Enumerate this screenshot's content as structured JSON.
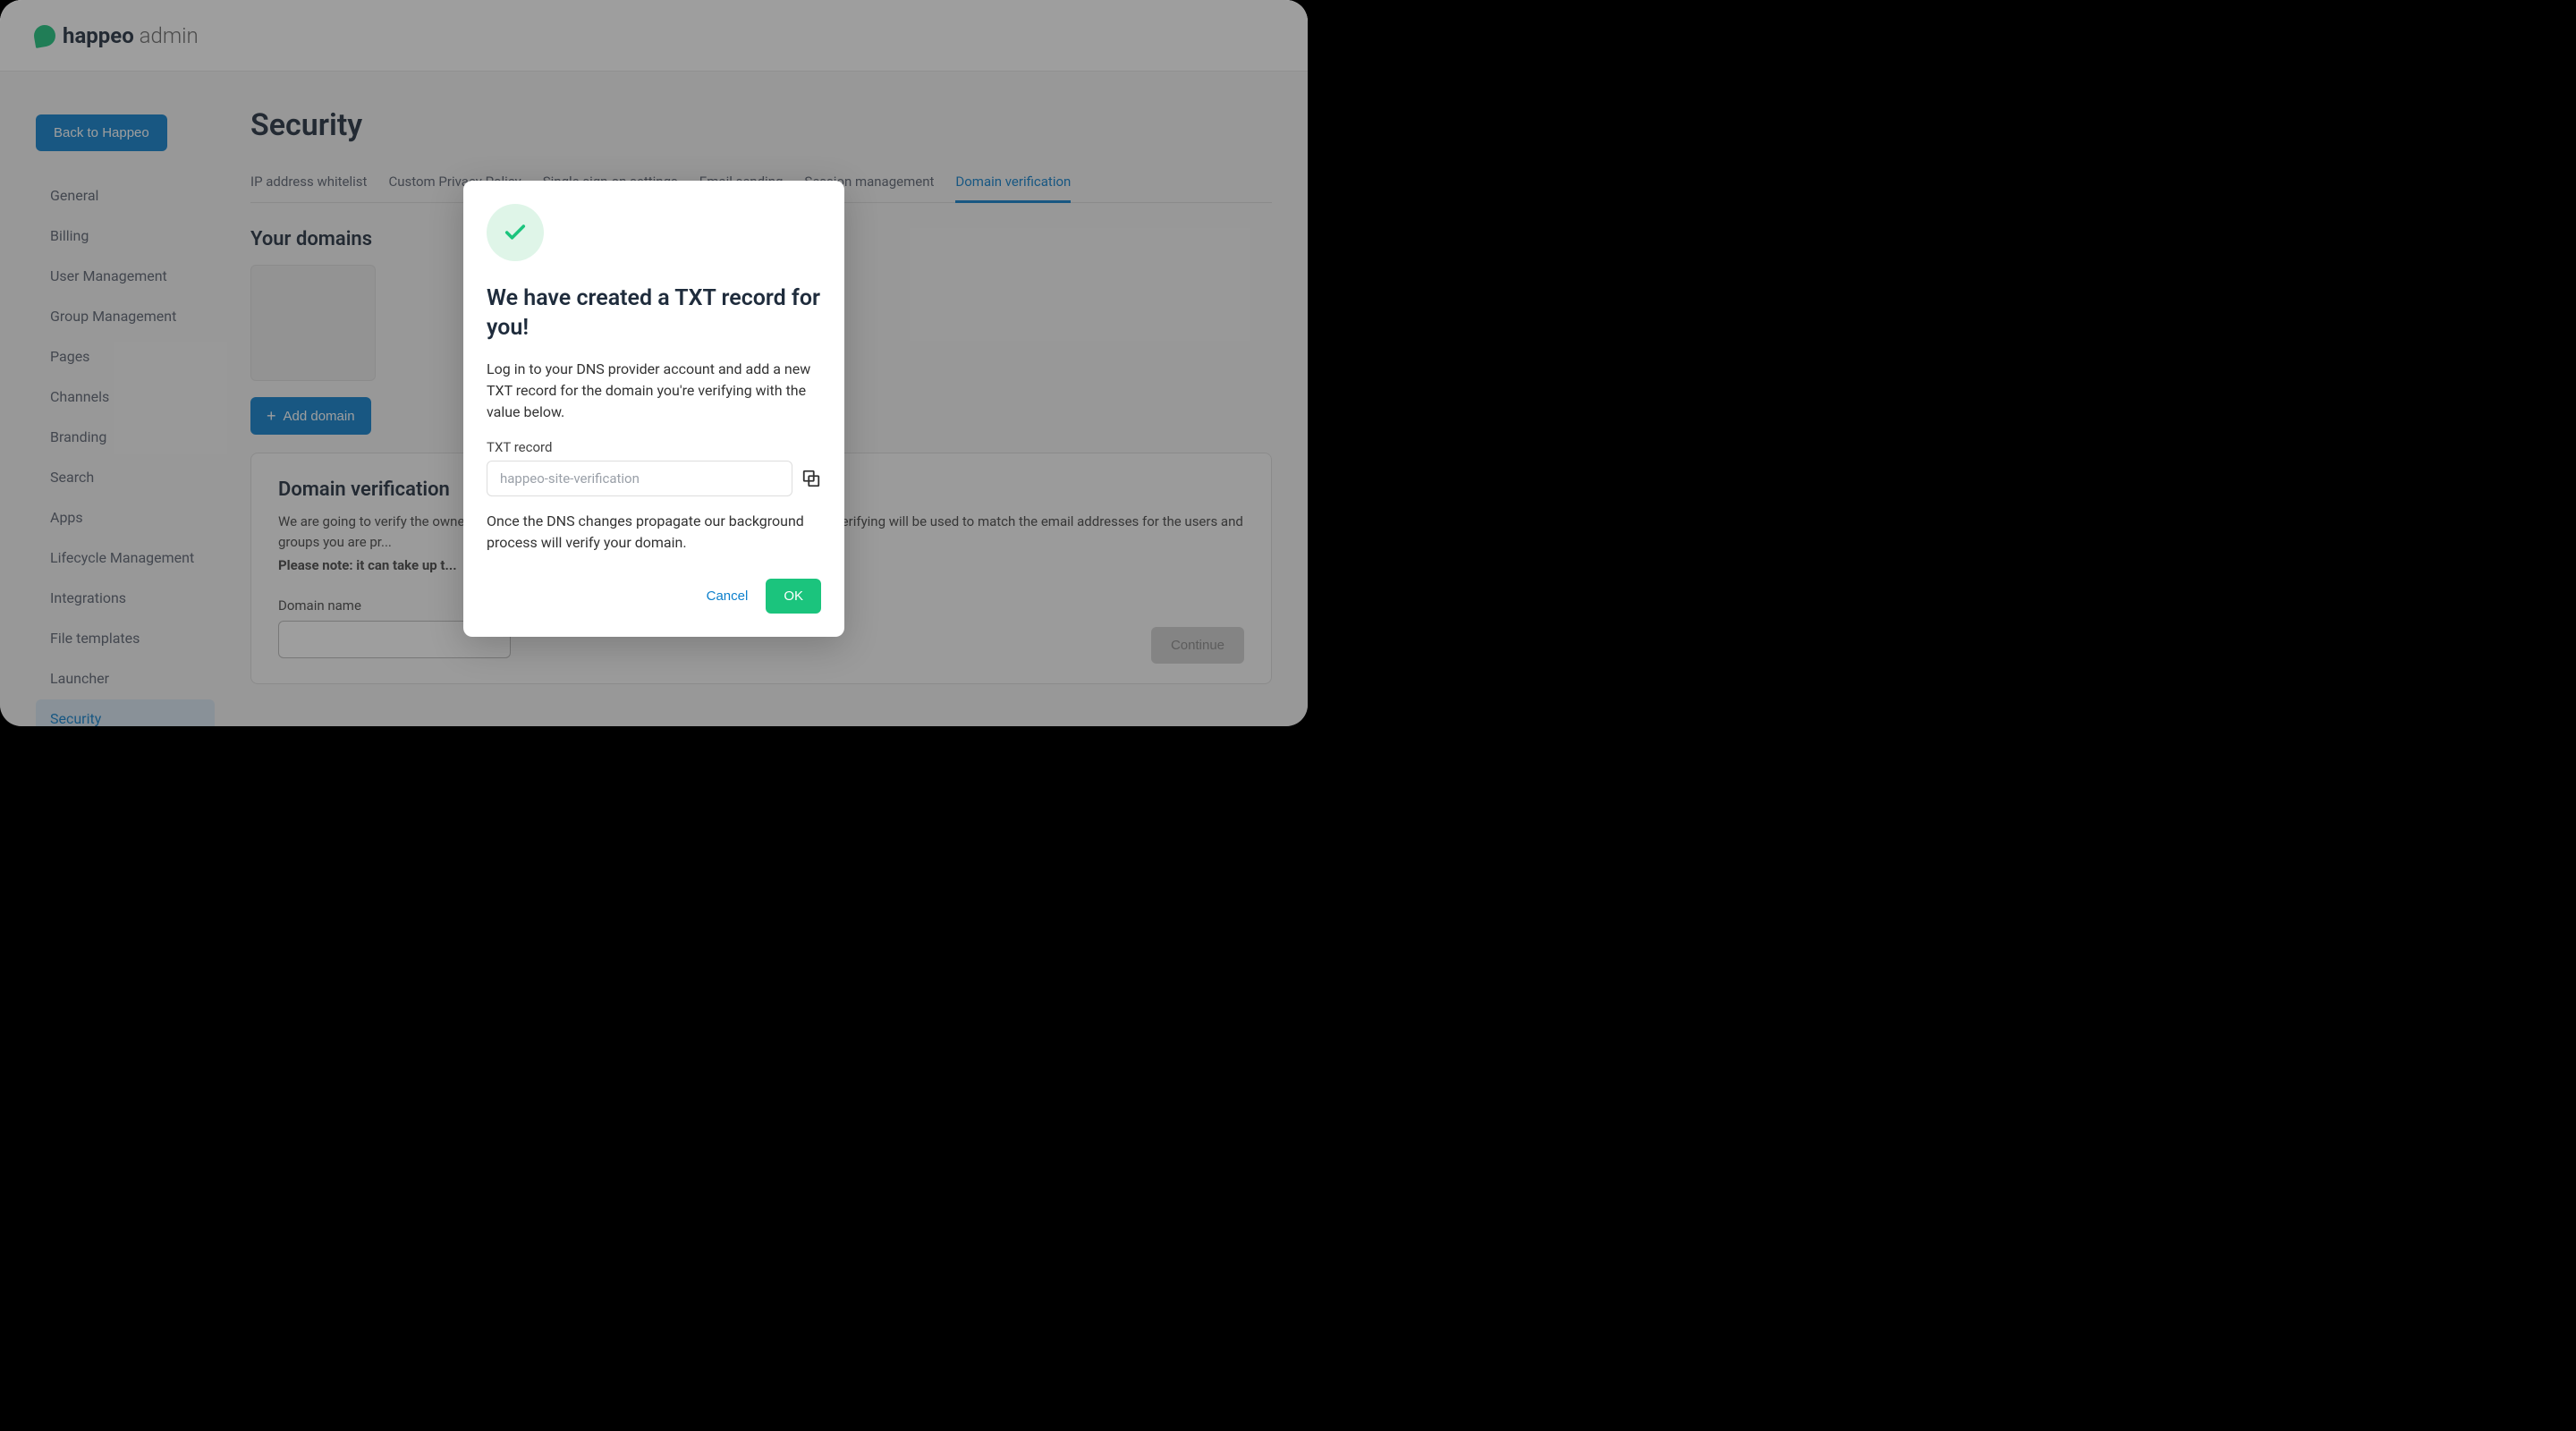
{
  "brand": {
    "name_bold": "happeo",
    "name_thin": " admin"
  },
  "sidebar": {
    "back_label": "Back to Happeo",
    "items": [
      {
        "label": "General"
      },
      {
        "label": "Billing"
      },
      {
        "label": "User Management"
      },
      {
        "label": "Group Management"
      },
      {
        "label": "Pages"
      },
      {
        "label": "Channels"
      },
      {
        "label": "Branding"
      },
      {
        "label": "Search"
      },
      {
        "label": "Apps"
      },
      {
        "label": "Lifecycle Management"
      },
      {
        "label": "Integrations"
      },
      {
        "label": "File templates"
      },
      {
        "label": "Launcher"
      },
      {
        "label": "Security"
      }
    ],
    "active_index": 13
  },
  "page_title": "Security",
  "tabs": {
    "items": [
      {
        "label": "IP address whitelist"
      },
      {
        "label": "Custom Privacy Policy"
      },
      {
        "label": "Single sign-on settings"
      },
      {
        "label": "Email sending"
      },
      {
        "label": "Session management"
      },
      {
        "label": "Domain verification"
      }
    ],
    "active_index": 5
  },
  "domains_section_title": "Your domains",
  "add_domain_label": "Add domain",
  "verification": {
    "title": "Domain verification",
    "body_line1": "We are going to verify the ownership of your domain. The domain names that you're ...ing and verifying will be used to match the email addresses for the users and groups you are pr...",
    "note": "Please note: it can take up t...",
    "domain_name_label": "Domain name",
    "continue_label": "Continue"
  },
  "modal": {
    "title": "We have created a TXT record for you!",
    "intro": "Log in to your DNS provider account and add a new TXT record for the domain you're verifying with the value below.",
    "txt_label": "TXT record",
    "txt_value": "happeo-site-verification",
    "outro": "Once the DNS changes propagate our background process will verify your domain.",
    "cancel_label": "Cancel",
    "ok_label": "OK"
  }
}
